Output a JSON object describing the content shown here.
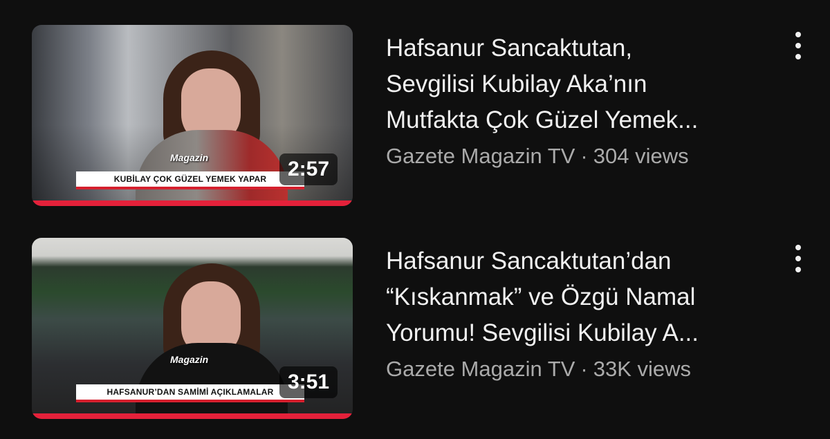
{
  "videos": [
    {
      "title_lines": [
        "Hafsanur Sancaktutan,",
        "Sevgilisi Kubilay Aka’nın",
        "Mutfakta Çok Güzel Yemek..."
      ],
      "channel": "Gazete Magazin TV",
      "separator": "·",
      "views": "304 views",
      "duration": "2:57",
      "thumbnail": {
        "logo_text": "Magazin",
        "caption": "KUBİLAY ÇOK GÜZEL YEMEK YAPAR"
      },
      "menu_icon": "more-vertical-icon"
    },
    {
      "title_lines": [
        "Hafsanur Sancaktutan’dan",
        "“Kıskanmak” ve Özgü Namal",
        "Yorumu! Sevgilisi Kubilay A..."
      ],
      "channel": "Gazete Magazin TV",
      "separator": "·",
      "views": "33K views",
      "duration": "3:51",
      "thumbnail": {
        "logo_text": "Magazin",
        "caption": "HAFSANUR’DAN SAMİMİ AÇIKLAMALAR"
      },
      "menu_icon": "more-vertical-icon"
    }
  ],
  "colors": {
    "background": "#0f0f0f",
    "title": "#f1f1f1",
    "meta": "#aaaaaa",
    "progress": "#e4213a"
  }
}
